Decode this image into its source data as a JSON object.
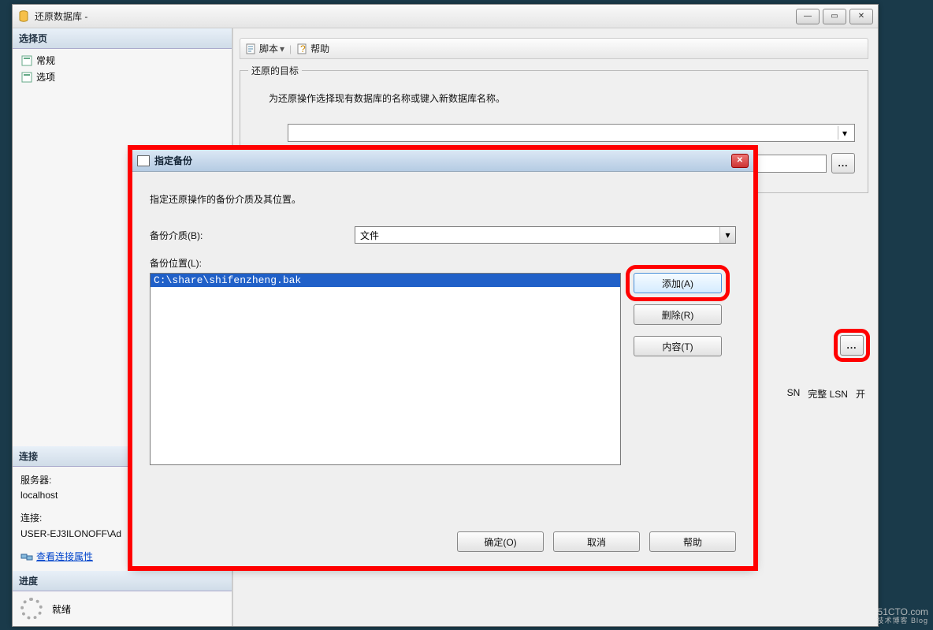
{
  "window": {
    "title": "还原数据库 -"
  },
  "left": {
    "select_page": "选择页",
    "nav": [
      {
        "label": "常规"
      },
      {
        "label": "选项"
      }
    ],
    "connection_header": "连接",
    "server_label": "服务器:",
    "server_value": "localhost",
    "conn_label": "连接:",
    "conn_value": "USER-EJ3ILONOFF\\Ad",
    "view_conn_props": "查看连接属性",
    "progress_header": "进度",
    "progress_status": "就绪"
  },
  "toolbar": {
    "script": "脚本",
    "help": "帮助"
  },
  "fieldset1": {
    "legend": "还原的目标",
    "info": "为还原操作选择现有数据库的名称或键入新数据库名称。"
  },
  "browse_label": "...",
  "columns": {
    "sn": "SN",
    "full_lsn": "完整 LSN",
    "open": "开"
  },
  "modal": {
    "title": "指定备份",
    "desc": "指定还原操作的备份介质及其位置。",
    "media_label": "备份介质(B):",
    "media_value": "文件",
    "location_label": "备份位置(L):",
    "location_item": "C:\\share\\shifenzheng.bak",
    "btn_add": "添加(A)",
    "btn_remove": "删除(R)",
    "btn_contents": "内容(T)",
    "btn_ok": "确定(O)",
    "btn_cancel": "取消",
    "btn_help": "帮助"
  },
  "watermark": {
    "l1": "51CTO.com",
    "l2": "技术博客  Blog"
  }
}
